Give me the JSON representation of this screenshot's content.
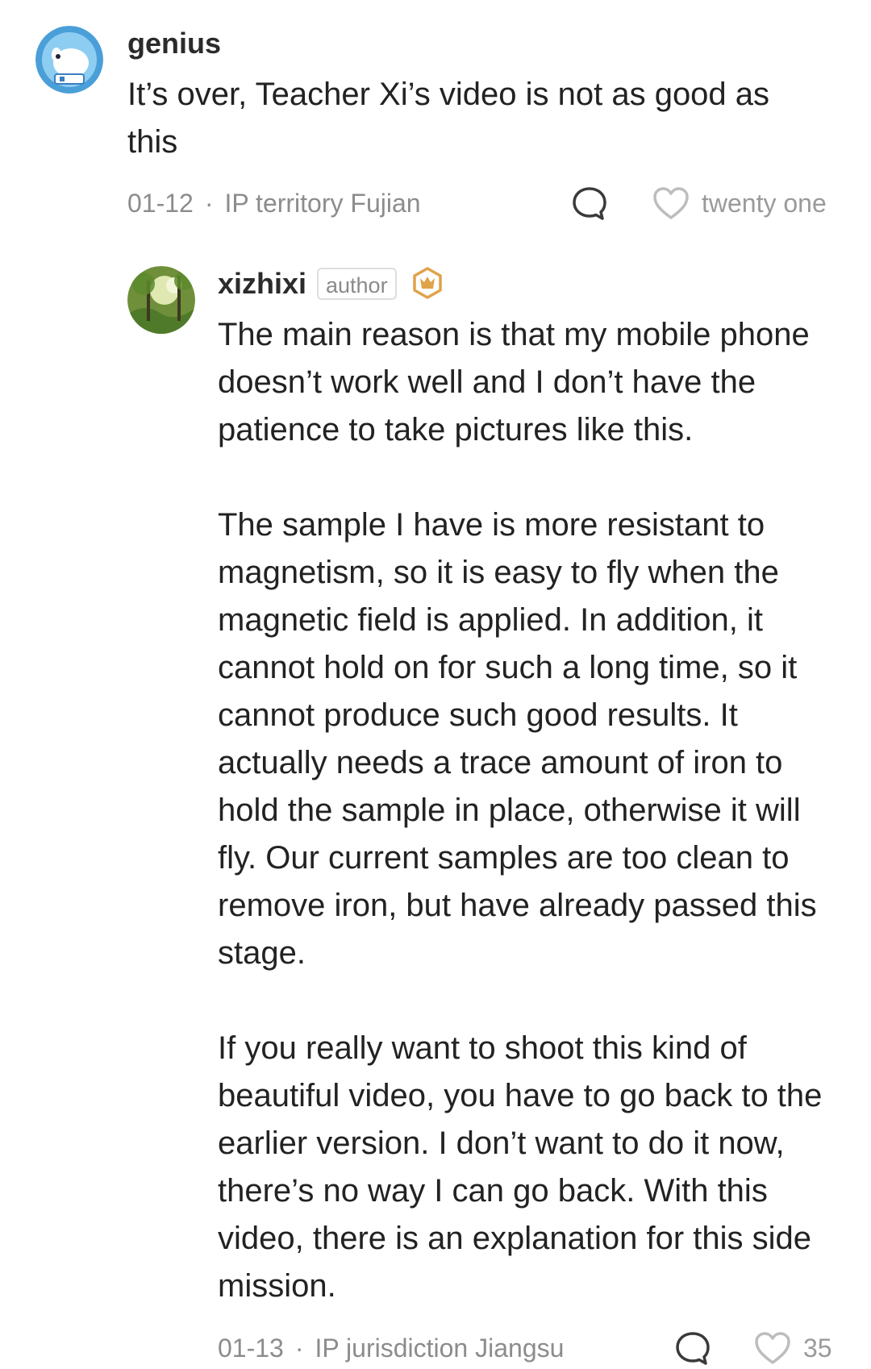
{
  "comments": [
    {
      "username": "genius",
      "text": "It’s over, Teacher Xi’s video is not as good as this",
      "date": "01-12",
      "location": "IP territory Fujian",
      "likes": "twenty one"
    }
  ],
  "reply": {
    "username": "xizhixi",
    "badge": "author",
    "text": "The main reason is that my mobile phone doesn’t work well and I don’t have the patience to take pictures like this.\n\nThe sample I have is more resistant to magnetism, so it is easy to fly when the magnetic field is applied. In addition, it cannot hold on for such a long time, so it cannot produce such good results. It actually needs a trace amount of iron to hold the sample in place, otherwise it will fly. Our current samples are too clean to remove iron, but have already passed this stage.\n\nIf you really want to shoot this kind of beautiful video, you have to go back to the earlier version. I don’t want to do it now, there’s no way I can go back. With this video, there is an explanation for this side mission.",
    "date": "01-13",
    "location": "IP jurisdiction Jiangsu",
    "likes": "35"
  },
  "meta_separator": "·",
  "colors": {
    "meta_text": "#8c8c8c",
    "icon_stroke": "#3a3a3a",
    "heart_stroke": "#bdbdbd",
    "crown_badge": "#e0a24a"
  },
  "icons": {
    "reply": "speech-bubble-icon",
    "like": "heart-outline-icon",
    "author_rank": "crown-badge-icon"
  }
}
